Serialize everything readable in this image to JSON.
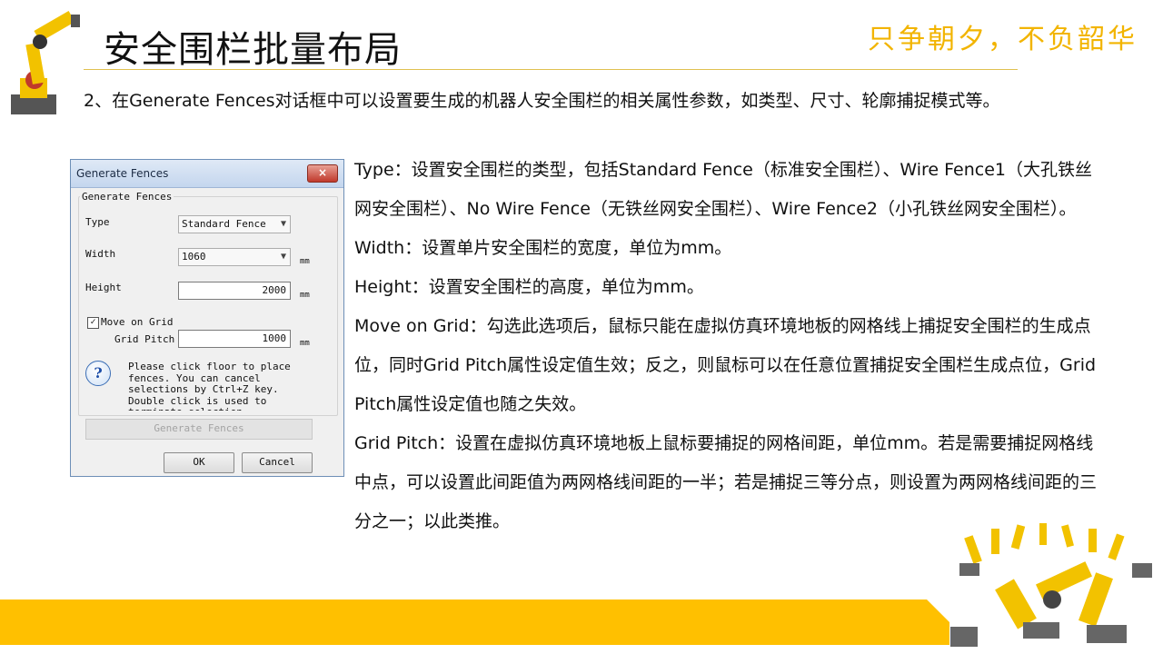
{
  "slide": {
    "title": "安全围栏批量布局",
    "slogan": "只争朝夕，不负韶华",
    "intro": "2、在Generate Fences对话框中可以设置要生成的机器人安全围栏的相关属性参数，如类型、尺寸、轮廓捕捉模式等。",
    "description": [
      "Type：设置安全围栏的类型，包括Standard Fence（标准安全围栏）、Wire Fence1（大孔铁丝网安全围栏）、No Wire Fence（无铁丝网安全围栏）、Wire Fence2（小孔铁丝网安全围栏）。",
      "Width：设置单片安全围栏的宽度，单位为mm。",
      "Height：设置安全围栏的高度，单位为mm。",
      "Move on Grid：勾选此选项后，鼠标只能在虚拟仿真环境地板的网格线上捕捉安全围栏的生成点位，同时Grid Pitch属性设定值生效；反之，则鼠标可以在任意位置捕捉安全围栏生成点位，Grid Pitch属性设定值也随之失效。",
      "Grid Pitch：设置在虚拟仿真环境地板上鼠标要捕捉的网格间距，单位mm。若是需要捕捉网格线中点，可以设置此间距值为两网格线间距的一半；若是捕捉三等分点，则设置为两网格线间距的三分之一；以此类推。"
    ]
  },
  "dialog": {
    "title": "Generate Fences",
    "close_label": "×",
    "group_label": "Generate Fences",
    "type_label": "Type",
    "type_value": "Standard Fence",
    "width_label": "Width",
    "width_value": "1060",
    "height_label": "Height",
    "height_value": "2000",
    "unit": "mm",
    "move_on_grid_label": "Move on Grid",
    "move_on_grid_checked": true,
    "check_mark": "✓",
    "grid_pitch_label": "Grid Pitch",
    "grid_pitch_value": "1000",
    "info_glyph": "?",
    "info_text": "Please click floor to place fences. You can cancel selections by Ctrl+Z key. Double click is used to terminate selection.",
    "generate_button": "Generate Fences",
    "ok_button": "OK",
    "cancel_button": "Cancel"
  },
  "colors": {
    "accent_yellow": "#F2B400",
    "footer_yellow": "#FFC000"
  }
}
